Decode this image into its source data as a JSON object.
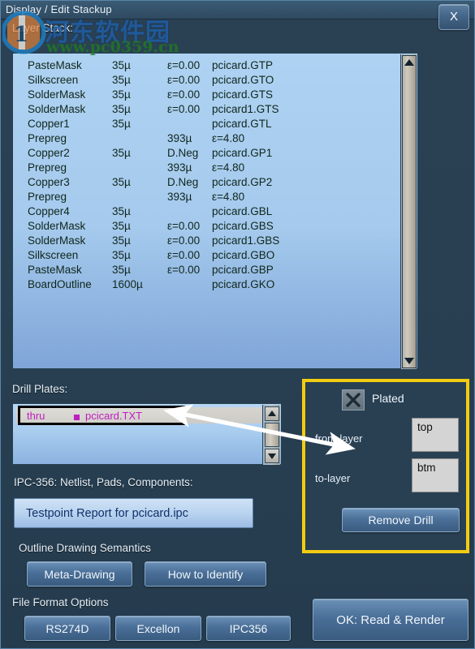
{
  "window": {
    "title": "Display / Edit Stackup",
    "close_label": "X"
  },
  "watermark": {
    "text_cn": "河东软件园",
    "url": "www.pc0359.cn"
  },
  "layer_stack": {
    "label": "Layer Stack:",
    "rows": [
      {
        "name": "PasteMask",
        "thickness": "35µ",
        "mid": "ε=0.00",
        "file": "pcicard.GTP"
      },
      {
        "name": "Silkscreen",
        "thickness": "35µ",
        "mid": "ε=0.00",
        "file": "pcicard.GTO"
      },
      {
        "name": "SolderMask",
        "thickness": "35µ",
        "mid": "ε=0.00",
        "file": "pcicard.GTS"
      },
      {
        "name": "SolderMask",
        "thickness": "35µ",
        "mid": "ε=0.00",
        "file": "pcicard1.GTS"
      },
      {
        "name": "Copper1",
        "thickness": "35µ",
        "mid": "",
        "file": "pcicard.GTL"
      },
      {
        "name": "Prepreg",
        "thickness": "",
        "mid": "393µ",
        "file": "ε=4.80"
      },
      {
        "name": "Copper2",
        "thickness": "35µ",
        "mid": "D.Neg",
        "file": "pcicard.GP1"
      },
      {
        "name": "Prepreg",
        "thickness": "",
        "mid": "393µ",
        "file": "ε=4.80"
      },
      {
        "name": "Copper3",
        "thickness": "35µ",
        "mid": "D.Neg",
        "file": "pcicard.GP2"
      },
      {
        "name": "Prepreg",
        "thickness": "",
        "mid": "393µ",
        "file": "ε=4.80"
      },
      {
        "name": "Copper4",
        "thickness": "35µ",
        "mid": "",
        "file": "pcicard.GBL"
      },
      {
        "name": "SolderMask",
        "thickness": "35µ",
        "mid": "ε=0.00",
        "file": "pcicard.GBS"
      },
      {
        "name": "SolderMask",
        "thickness": "35µ",
        "mid": "ε=0.00",
        "file": "pcicard1.GBS"
      },
      {
        "name": "Silkscreen",
        "thickness": "35µ",
        "mid": "ε=0.00",
        "file": "pcicard.GBO"
      },
      {
        "name": "PasteMask",
        "thickness": "35µ",
        "mid": "ε=0.00",
        "file": "pcicard.GBP"
      },
      {
        "name": "BoardOutline",
        "thickness": "1600µ",
        "mid": "",
        "file": "pcicard.GKO"
      }
    ]
  },
  "drill_plates": {
    "label": "Drill Plates:",
    "selected_row": {
      "span": "thru",
      "file": "pcicard.TXT",
      "marker_color": "#c01ec0"
    }
  },
  "drill_detail": {
    "plated_label": "Plated",
    "plated_checked": true,
    "from_layer_label": "from-layer",
    "from_layer_value": "top",
    "to_layer_label": "to-layer",
    "to_layer_value": "btm",
    "remove_label": "Remove Drill",
    "highlight_color": "#f2cc12"
  },
  "ipc356": {
    "label": "IPC-356: Netlist, Pads, Components:",
    "button_label": "Testpoint Report for pcicard.ipc"
  },
  "outline_semantics": {
    "label": "Outline Drawing Semantics",
    "buttons": [
      {
        "label": "Meta-Drawing"
      },
      {
        "label": "How to Identify"
      }
    ]
  },
  "file_format": {
    "label": "File Format Options",
    "buttons": [
      {
        "label": "RS274D"
      },
      {
        "label": "Excellon"
      },
      {
        "label": "IPC356"
      }
    ]
  },
  "ok_button": {
    "label": "OK:  Read & Render"
  }
}
